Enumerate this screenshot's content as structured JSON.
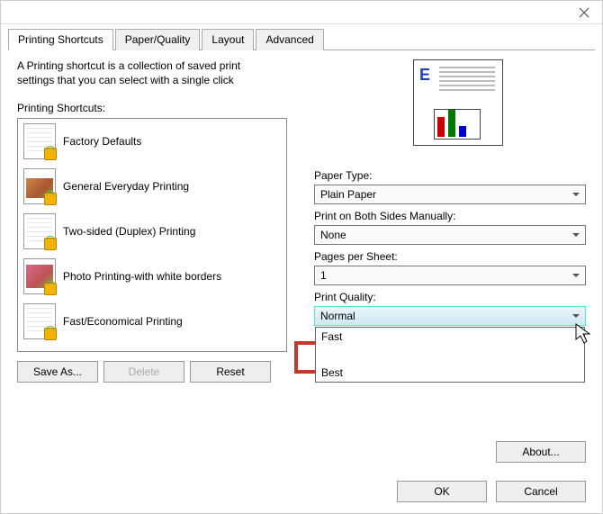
{
  "tabs": {
    "printing_shortcuts": "Printing Shortcuts",
    "paper_quality": "Paper/Quality",
    "layout": "Layout",
    "advanced": "Advanced"
  },
  "description": "A Printing shortcut is a collection of saved print settings that you can select with a single click",
  "list_label": "Printing Shortcuts:",
  "shortcuts": [
    {
      "label": "Factory Defaults"
    },
    {
      "label": "General Everyday Printing"
    },
    {
      "label": "Two-sided (Duplex) Printing"
    },
    {
      "label": "Photo Printing-with white borders"
    },
    {
      "label": "Fast/Economical Printing"
    }
  ],
  "buttons": {
    "save_as": "Save As...",
    "delete": "Delete",
    "reset": "Reset",
    "about": "About...",
    "ok": "OK",
    "cancel": "Cancel"
  },
  "fields": {
    "paper_type": {
      "label": "Paper Type:",
      "value": "Plain Paper"
    },
    "both_sides": {
      "label": "Print on Both Sides Manually:",
      "value": "None"
    },
    "pages_per_sheet": {
      "label": "Pages per Sheet:",
      "value": "1"
    },
    "print_quality": {
      "label": "Print Quality:",
      "value": "Normal",
      "options": [
        "Fast",
        "Best"
      ]
    }
  },
  "preview_letter": "E"
}
